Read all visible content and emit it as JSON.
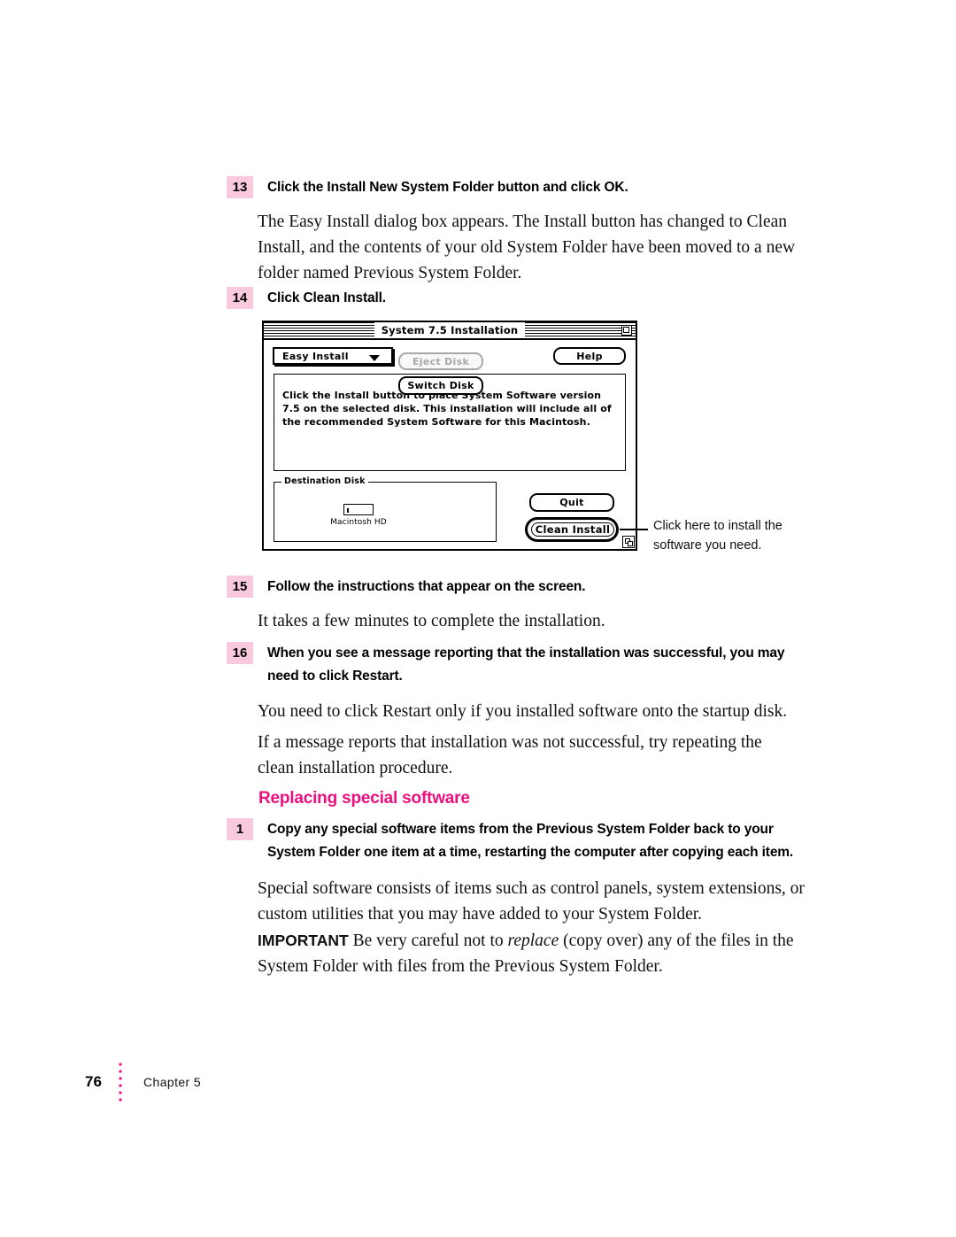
{
  "page": {
    "folio": "76",
    "chapter_label": "Chapter 5"
  },
  "steps": [
    {
      "number": "13",
      "title": "Click the Install New System Folder button and click OK.",
      "body": "The Easy Install dialog box appears. The Install button has changed to Clean Install, and the contents of your old System Folder have been moved to a new folder named Previous System Folder."
    },
    {
      "number": "14",
      "title": "Click Clean Install."
    },
    {
      "number": "15",
      "title": "Follow the instructions that appear on the screen.",
      "body": "It takes a few minutes to complete the installation."
    },
    {
      "number": "16",
      "title": "When you see a message reporting that the installation was successful, you may need to click Restart.",
      "body": "You need to click Restart only if you installed software onto the startup disk.",
      "body2": "If a message reports that installation was not successful, try repeating the clean installation procedure."
    }
  ],
  "section": {
    "heading": "Replacing special software",
    "heading_color": "#ec0f7e",
    "step": {
      "number": "1",
      "title": "Copy any special software items from the Previous System Folder back to your System Folder one item at a time, restarting the computer after copying each item.",
      "body": "Special software consists of items such as control panels, system extensions, or custom utilities that you may have added to your System Folder."
    },
    "important_label": "IMPORTANT",
    "important_before": " Be very careful not to ",
    "important_italic": "replace",
    "important_after": " (copy over) any of the files in the System Folder with files from the Previous System Folder."
  },
  "dialog": {
    "title": "System 7.5 Installation",
    "popup_value": "Easy Install",
    "help_label": "Help",
    "message": "Click the Install button to place System Software version 7.5 on the selected disk. This installation will include all of the recommended System Software for this Macintosh.",
    "group_title": "Destination Disk",
    "disk_name": "Macintosh HD",
    "eject_label": "Eject Disk",
    "switch_label": "Switch Disk",
    "quit_label": "Quit",
    "clean_install_label": "Clean Install"
  },
  "callout": {
    "line1": "Click here to install the",
    "line2": "software you need."
  }
}
